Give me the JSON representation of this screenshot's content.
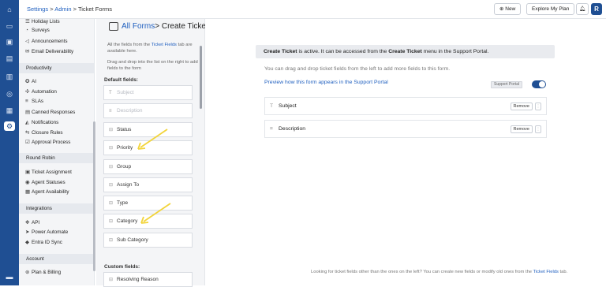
{
  "breadcrumb": {
    "settings": "Settings",
    "sep1": " > ",
    "admin": "Admin",
    "sep2": " > ",
    "current": "Ticket Forms"
  },
  "topbar": {
    "new_label": "New",
    "explore_label": "Explore My Plan",
    "avatar_initial": "R"
  },
  "sidebar": {
    "top_items": [
      {
        "icon": "list-icon",
        "label": "Holiday Lists"
      },
      {
        "icon": "survey-icon",
        "label": "Surveys"
      },
      {
        "icon": "megaphone-icon",
        "label": "Announcements"
      },
      {
        "icon": "mail-icon",
        "label": "Email Deliverability"
      }
    ],
    "productivity": {
      "title": "Productivity",
      "items": [
        {
          "icon": "ai-icon",
          "label": "AI"
        },
        {
          "icon": "automation-icon",
          "label": "Automation"
        },
        {
          "icon": "sla-icon",
          "label": "SLAs"
        },
        {
          "icon": "canned-icon",
          "label": "Canned Responses"
        },
        {
          "icon": "bell-icon",
          "label": "Notifications"
        },
        {
          "icon": "rules-icon",
          "label": "Closure Rules"
        },
        {
          "icon": "approval-icon",
          "label": "Approval Process"
        }
      ]
    },
    "round_robin": {
      "title": "Round Robin",
      "items": [
        {
          "icon": "assign-icon",
          "label": "Ticket Assignment"
        },
        {
          "icon": "status-icon",
          "label": "Agent Statuses"
        },
        {
          "icon": "calendar-icon",
          "label": "Agent Availability"
        }
      ]
    },
    "integrations": {
      "title": "Integrations",
      "items": [
        {
          "icon": "api-icon",
          "label": "API"
        },
        {
          "icon": "power-automate-icon",
          "label": "Power Automate"
        },
        {
          "icon": "entra-icon",
          "label": "Entra ID Sync"
        }
      ]
    },
    "account": {
      "title": "Account",
      "items": [
        {
          "icon": "billing-icon",
          "label": "Plan & Billing"
        }
      ]
    }
  },
  "page": {
    "all_forms": "All Forms",
    "title_sep": "> ",
    "title": "Create Ticket"
  },
  "fields_panel": {
    "help1_pre": "All the fields from the ",
    "help1_link": "Ticket Fields",
    "help1_post": " tab are available here.",
    "help2": "Drag and drop into the list on the right to add fields to the form",
    "default_label": "Default fields:",
    "default_fields": [
      {
        "label": "Subject",
        "disabled": true,
        "icon": "text-icon"
      },
      {
        "label": "Description",
        "disabled": true,
        "icon": "paragraph-icon"
      },
      {
        "label": "Status",
        "disabled": false,
        "icon": "dropdown-icon"
      },
      {
        "label": "Priority",
        "disabled": false,
        "icon": "dropdown-icon"
      },
      {
        "label": "Group",
        "disabled": false,
        "icon": "dropdown-icon"
      },
      {
        "label": "Assign To",
        "disabled": false,
        "icon": "dropdown-icon"
      },
      {
        "label": "Type",
        "disabled": false,
        "icon": "dropdown-icon"
      },
      {
        "label": "Category",
        "disabled": false,
        "icon": "dropdown-icon"
      },
      {
        "label": "Sub Category",
        "disabled": false,
        "icon": "dropdown-icon"
      }
    ],
    "custom_label": "Custom fields:",
    "custom_fields": [
      {
        "label": "Resolving Reason",
        "icon": "dropdown-icon"
      }
    ]
  },
  "main": {
    "banner_pre": "Create Ticket",
    "banner_mid": " is active. It can be accessed from the ",
    "banner_bold": "Create Ticket",
    "banner_post": " menu in the Support Portal.",
    "hint": "You can drag and drop ticket fields from the left to add more fields to this form.",
    "preview_link": "Preview how this form appears in the Support Portal",
    "portal_badge": "Support Portal",
    "form_fields": [
      {
        "label": "Subject",
        "icon": "text-icon",
        "remove": "Remove"
      },
      {
        "label": "Description",
        "icon": "paragraph-icon",
        "remove": "Remove"
      }
    ],
    "footer_pre": "Looking for ticket fields other than the ones on the left? You can create new fields or modify old ones from the ",
    "footer_link": "Ticket Fields",
    "footer_post": " tab."
  },
  "colors": {
    "brand": "#1f4f93",
    "link": "#1f5fbf",
    "annotation_arrow": "#f2d43a"
  }
}
